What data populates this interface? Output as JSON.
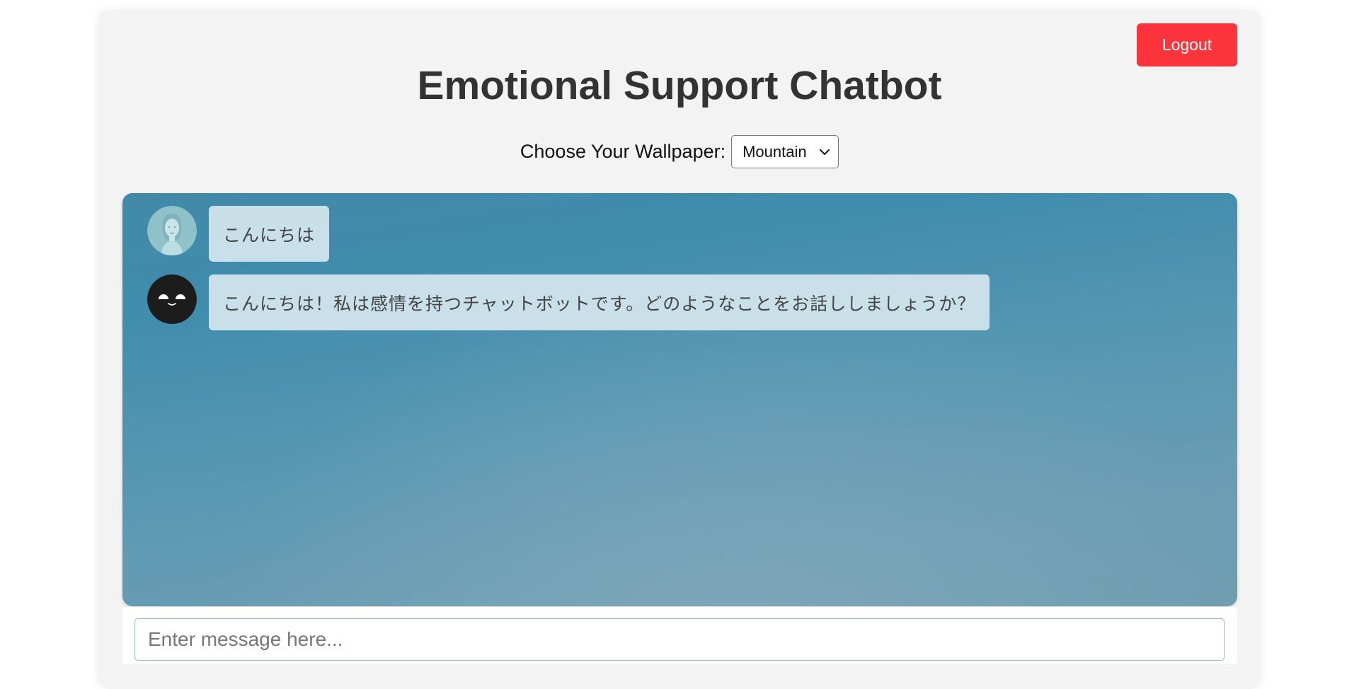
{
  "header": {
    "title": "Emotional Support Chatbot",
    "logout_label": "Logout"
  },
  "wallpaper": {
    "label": "Choose Your Wallpaper:",
    "selected": "Mountain"
  },
  "chat": {
    "messages": [
      {
        "sender": "user",
        "avatar": "user-avatar-icon",
        "text": "こんにちは"
      },
      {
        "sender": "bot",
        "avatar": "bot-face-icon",
        "text": "こんにちは！私は感情を持つチャットボットです。どのようなことをお話ししましょうか？"
      }
    ]
  },
  "composer": {
    "placeholder": "Enter message here..."
  },
  "colors": {
    "logout": "#fe343c",
    "card": "#f3f3f3",
    "chat_bg_top": "#3f8cad",
    "bubble": "#d5e6ee"
  }
}
